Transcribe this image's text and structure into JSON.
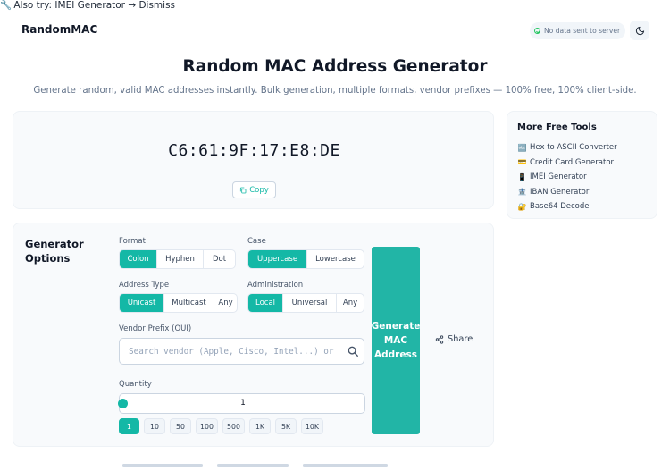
{
  "topbar": {
    "icon": "wrench-icon",
    "text": "Also try: IMEI Generator → Dismiss"
  },
  "header": {
    "brand": "RandomMAC",
    "privacy_badge": "No data sent to server",
    "theme_icon": "moon-icon"
  },
  "hero": {
    "title": "Random MAC Address Generator",
    "subtitle": "Generate random, valid MAC addresses instantly. Bulk generation, multiple formats, vendor prefixes — 100% free, 100% client-side."
  },
  "result": {
    "mac": "C6:61:9F:17:E8:DE",
    "copy_label": "Copy"
  },
  "tools": {
    "title": "More Free Tools",
    "items": [
      {
        "icon": "🔤",
        "label": "Hex to ASCII Converter"
      },
      {
        "icon": "💳",
        "label": "Credit Card Generator"
      },
      {
        "icon": "📱",
        "label": "IMEI Generator"
      },
      {
        "icon": "🏦",
        "label": "IBAN Generator"
      },
      {
        "icon": "🔐",
        "label": "Base64 Decode"
      }
    ]
  },
  "options": {
    "title": "Generator Options",
    "format": {
      "label": "Format",
      "options": [
        "Colon",
        "Hyphen",
        "Dot"
      ],
      "selected": "Colon"
    },
    "case": {
      "label": "Case",
      "options": [
        "Uppercase",
        "Lowercase"
      ],
      "selected": "Uppercase"
    },
    "address_type": {
      "label": "Address Type",
      "options": [
        "Unicast",
        "Multicast",
        "Any"
      ],
      "selected": "Unicast"
    },
    "administration": {
      "label": "Administration",
      "options": [
        "Local",
        "Universal",
        "Any"
      ],
      "selected": "Local"
    },
    "vendor": {
      "label": "Vendor Prefix (OUI)",
      "placeholder": "Search vendor (Apple, Cisco, Intel...) or enter OUI"
    },
    "quantity": {
      "label": "Quantity",
      "value": "1",
      "presets": [
        "1",
        "10",
        "50",
        "100",
        "500",
        "1K",
        "5K",
        "10K"
      ],
      "selected": "1"
    },
    "generate_label": "Generate MAC Address",
    "share_label": "Share"
  },
  "colors": {
    "accent": "#14b8a6",
    "card_bg": "#f8fafc",
    "muted": "#64748b"
  }
}
